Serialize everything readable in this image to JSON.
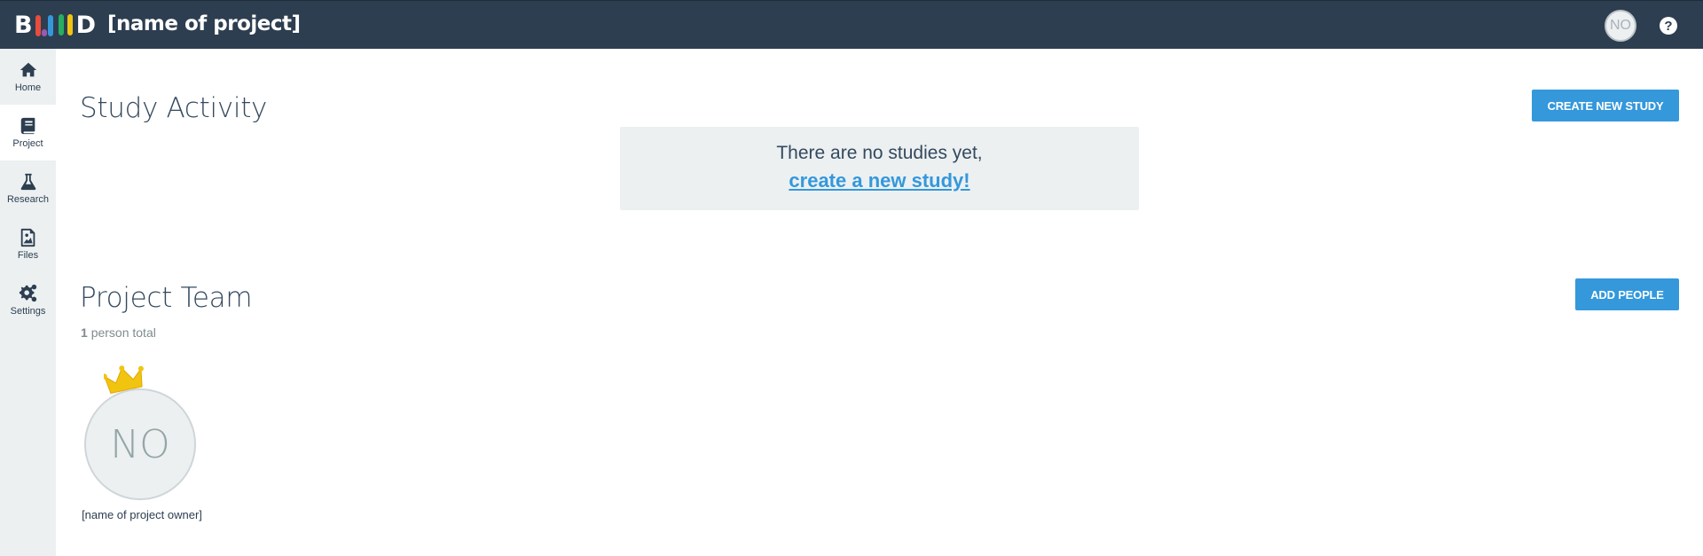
{
  "header": {
    "logo_text": "BUILD",
    "project_name": "[name of project]",
    "user_initials": "NO",
    "help_symbol": "?"
  },
  "sidebar": {
    "items": [
      {
        "label": "Home",
        "icon": "home-icon"
      },
      {
        "label": "Project",
        "icon": "book-icon",
        "active": true
      },
      {
        "label": "Research",
        "icon": "flask-icon"
      },
      {
        "label": "Files",
        "icon": "file-image-icon"
      },
      {
        "label": "Settings",
        "icon": "gears-icon"
      }
    ]
  },
  "study_activity": {
    "title": "Study Activity",
    "create_button": "CREATE NEW STUDY",
    "empty_text": "There are no studies yet,",
    "empty_link": "create a new study!"
  },
  "project_team": {
    "title": "Project Team",
    "add_button": "ADD PEOPLE",
    "count_number": "1",
    "count_suffix": "person total",
    "members": [
      {
        "initials": "NO",
        "name": "[name of project owner]",
        "is_owner": true
      }
    ]
  },
  "colors": {
    "topbar": "#2c3e50",
    "accent": "#3498db",
    "sidebar": "#ecf0f1",
    "crown": "#f1c40f"
  }
}
